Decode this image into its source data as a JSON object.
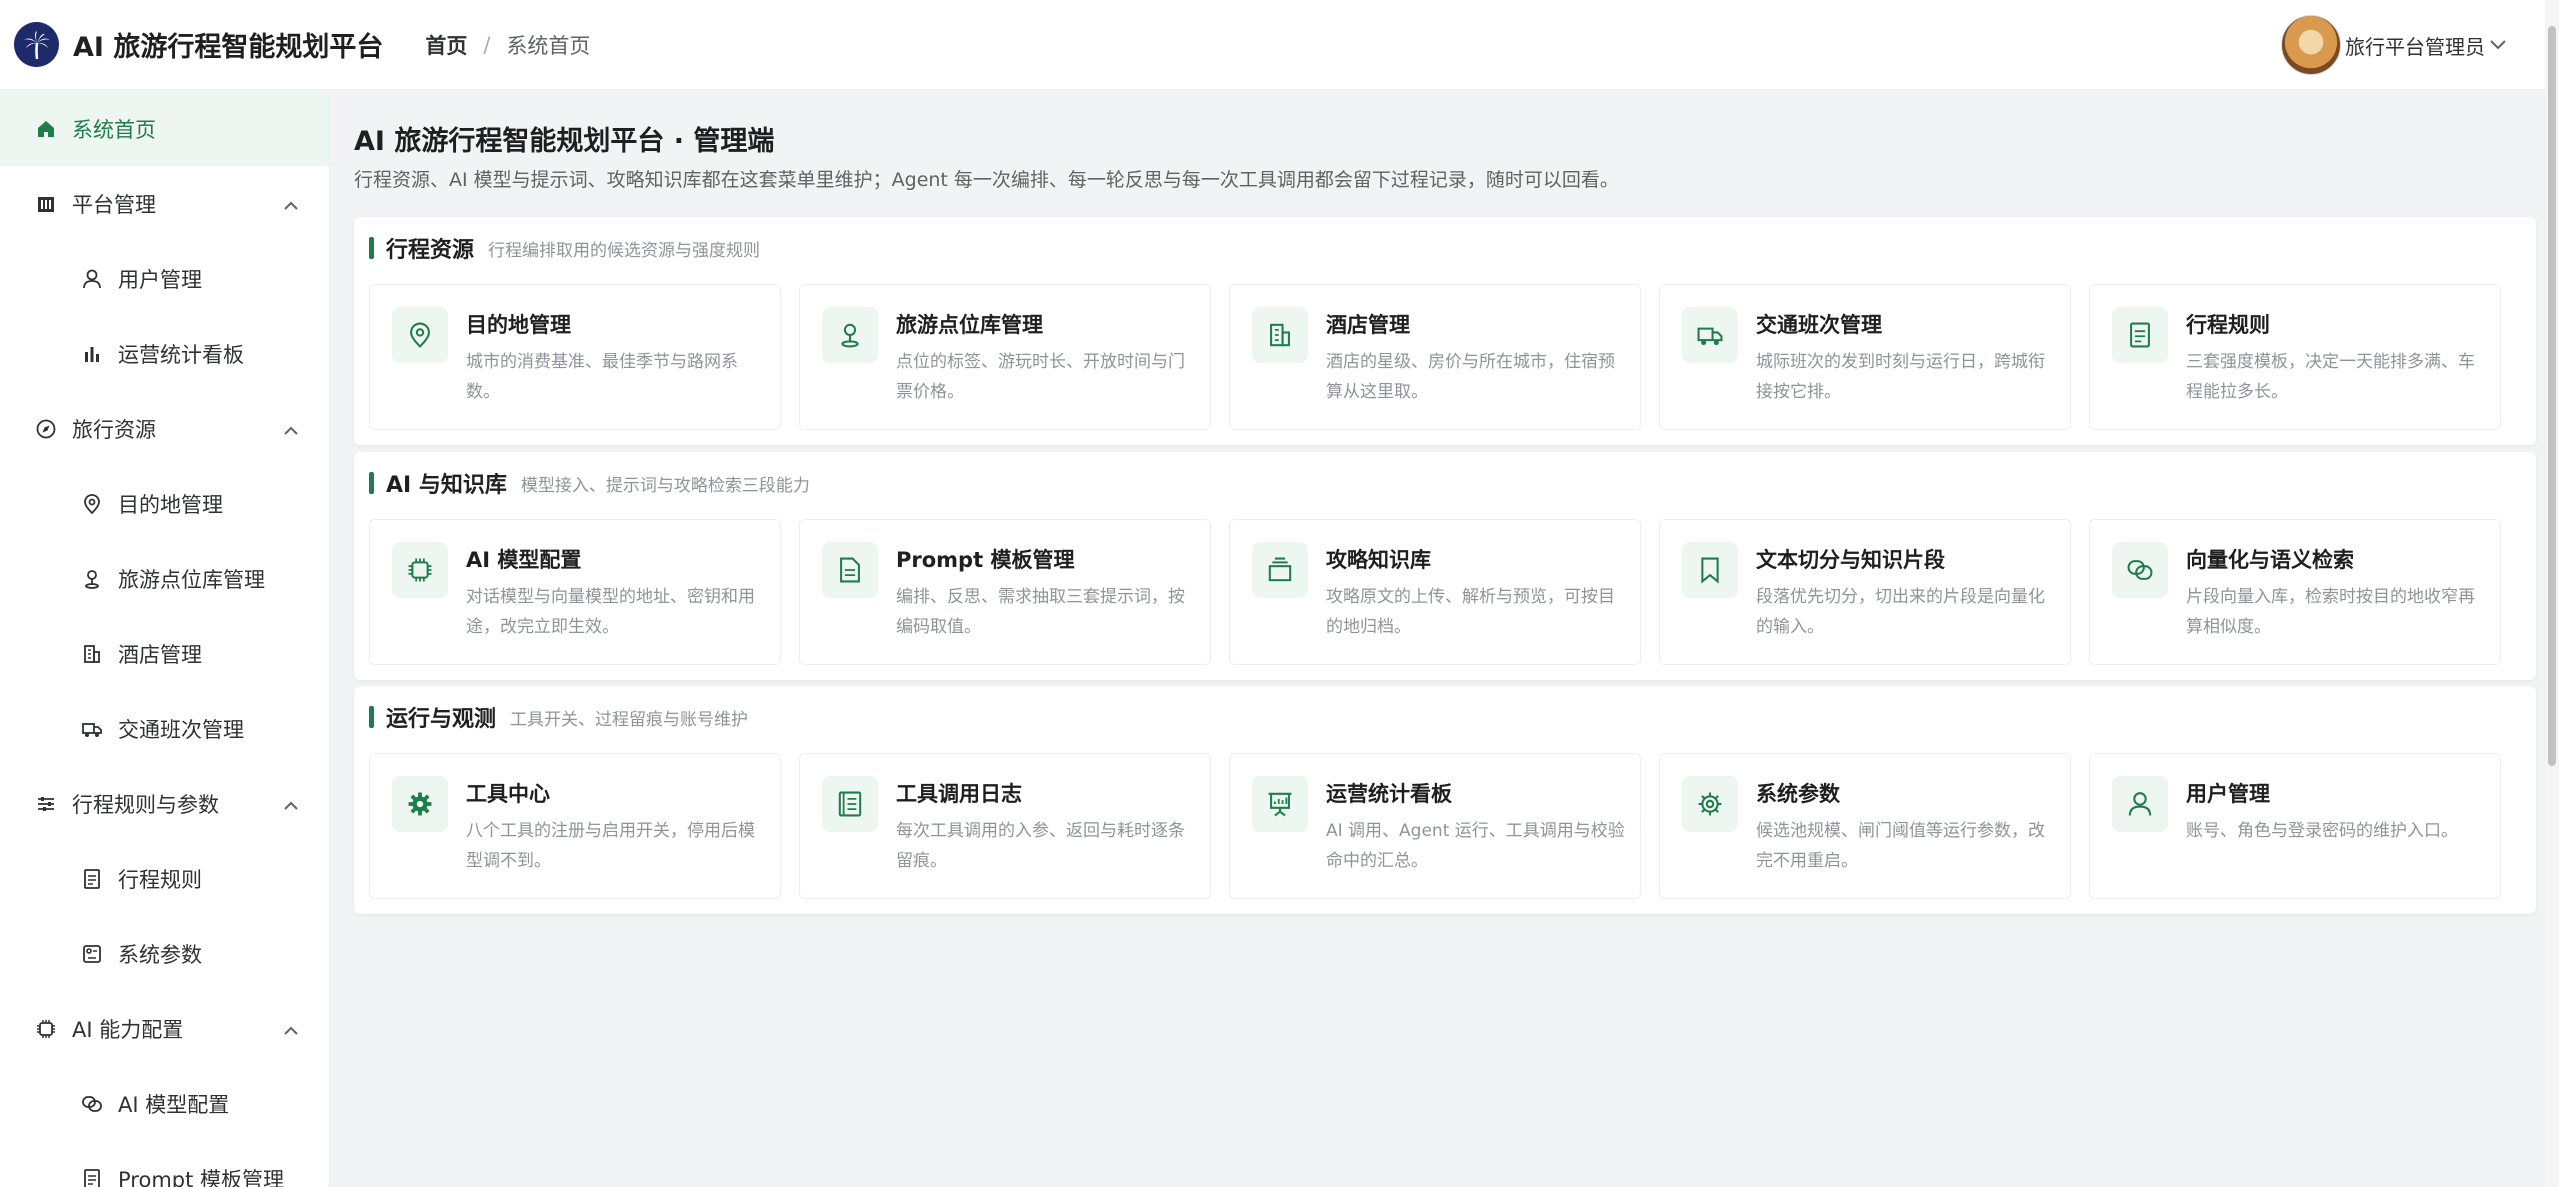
{
  "header": {
    "app_title": "AI 旅游行程智能规划平台",
    "breadcrumb": {
      "home": "首页",
      "separator": "/",
      "current": "系统首页"
    },
    "user_name": "旅行平台管理员"
  },
  "colors": {
    "accent": "#1e7d4b",
    "accent_bg": "#eef6f1",
    "logo_bg": "#1d2b6b"
  },
  "sidebar": {
    "items": [
      {
        "label": "系统首页",
        "icon": "home-icon",
        "level": 1,
        "active": true
      },
      {
        "label": "平台管理",
        "icon": "building-columns-icon",
        "level": 1,
        "expanded": true
      },
      {
        "label": "用户管理",
        "icon": "user-icon",
        "level": 2
      },
      {
        "label": "运营统计看板",
        "icon": "bar-chart-icon",
        "level": 2
      },
      {
        "label": "旅行资源",
        "icon": "compass-icon",
        "level": 1,
        "expanded": true
      },
      {
        "label": "目的地管理",
        "icon": "map-pin-icon",
        "level": 2
      },
      {
        "label": "旅游点位库管理",
        "icon": "location-icon",
        "level": 2
      },
      {
        "label": "酒店管理",
        "icon": "hotel-icon",
        "level": 2
      },
      {
        "label": "交通班次管理",
        "icon": "truck-icon",
        "level": 2
      },
      {
        "label": "行程规则与参数",
        "icon": "sliders-icon",
        "level": 1,
        "expanded": true
      },
      {
        "label": "行程规则",
        "icon": "document-icon",
        "level": 2
      },
      {
        "label": "系统参数",
        "icon": "settings-box-icon",
        "level": 2
      },
      {
        "label": "AI 能力配置",
        "icon": "chip-icon",
        "level": 1,
        "expanded": true
      },
      {
        "label": "AI 模型配置",
        "icon": "link-icon",
        "level": 2
      },
      {
        "label": "Prompt 模板管理",
        "icon": "document-icon",
        "level": 2
      }
    ]
  },
  "main": {
    "title": "AI 旅游行程智能规划平台 · 管理端",
    "description": "行程资源、AI 模型与提示词、攻略知识库都在这套菜单里维护；Agent 每一次编排、每一轮反思与每一次工具调用都会留下过程记录，随时可以回看。",
    "sections": [
      {
        "title": "行程资源",
        "subtitle": "行程编排取用的候选资源与强度规则",
        "cards": [
          {
            "title": "目的地管理",
            "desc": "城市的消费基准、最佳季节与路网系数。",
            "icon": "map-pin-icon"
          },
          {
            "title": "旅游点位库管理",
            "desc": "点位的标签、游玩时长、开放时间与门票价格。",
            "icon": "location-icon"
          },
          {
            "title": "酒店管理",
            "desc": "酒店的星级、房价与所在城市，住宿预算从这里取。",
            "icon": "hotel-icon"
          },
          {
            "title": "交通班次管理",
            "desc": "城际班次的发到时刻与运行日，跨城衔接按它排。",
            "icon": "truck-icon"
          },
          {
            "title": "行程规则",
            "desc": "三套强度模板，决定一天能排多满、车程能拉多长。",
            "icon": "document-icon"
          }
        ]
      },
      {
        "title": "AI 与知识库",
        "subtitle": "模型接入、提示词与攻略检索三段能力",
        "cards": [
          {
            "title": "AI 模型配置",
            "desc": "对话模型与向量模型的地址、密钥和用途，改完立即生效。",
            "icon": "chip-icon"
          },
          {
            "title": "Prompt 模板管理",
            "desc": "编排、反思、需求抽取三套提示词，按编码取值。",
            "icon": "document-icon"
          },
          {
            "title": "攻略知识库",
            "desc": "攻略原文的上传、解析与预览，可按目的地归档。",
            "icon": "box-icon"
          },
          {
            "title": "文本切分与知识片段",
            "desc": "段落优先切分，切出来的片段是向量化的输入。",
            "icon": "bookmark-icon"
          },
          {
            "title": "向量化与语义检索",
            "desc": "片段向量入库，检索时按目的地收窄再算相似度。",
            "icon": "link-icon"
          }
        ]
      },
      {
        "title": "运行与观测",
        "subtitle": "工具开关、过程留痕与账号维护",
        "cards": [
          {
            "title": "工具中心",
            "desc": "八个工具的注册与启用开关，停用后模型调不到。",
            "icon": "gear-filled-icon"
          },
          {
            "title": "工具调用日志",
            "desc": "每次工具调用的入参、返回与耗时逐条留痕。",
            "icon": "log-icon"
          },
          {
            "title": "运营统计看板",
            "desc": "AI 调用、Agent 运行、工具调用与校验命中的汇总。",
            "icon": "presentation-icon"
          },
          {
            "title": "系统参数",
            "desc": "候选池规模、闸门阈值等运行参数，改完不用重启。",
            "icon": "gear-icon"
          },
          {
            "title": "用户管理",
            "desc": "账号、角色与登录密码的维护入口。",
            "icon": "user-icon"
          }
        ]
      }
    ]
  }
}
